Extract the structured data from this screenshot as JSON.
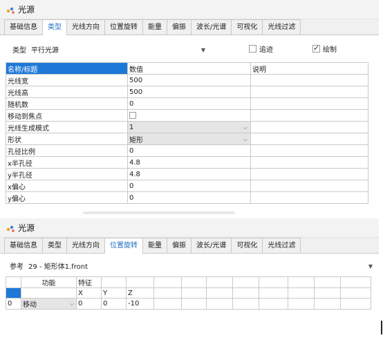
{
  "panel1": {
    "title": "光源",
    "tabs": [
      "基础信息",
      "类型",
      "光线方向",
      "位置旋转",
      "能量",
      "偏振",
      "波长/光谱",
      "可视化",
      "光线过滤"
    ],
    "active_tab": "类型",
    "type_label": "类型",
    "type_value": "平行光源",
    "trace_label": "追迹",
    "trace_checked": false,
    "draw_label": "绘制",
    "draw_checked": true,
    "table": {
      "headers": [
        "名称/标题",
        "数值",
        "说明"
      ],
      "rows": [
        {
          "name": "光线宽",
          "value": "500",
          "note": ""
        },
        {
          "name": "光线高",
          "value": "500",
          "note": ""
        },
        {
          "name": "随机数",
          "value": "0",
          "note": ""
        },
        {
          "name": "移动到焦点",
          "value": "",
          "note": "",
          "checkbox": true
        },
        {
          "name": "光线生成模式",
          "value": "1",
          "note": "",
          "combo": true
        },
        {
          "name": "形状",
          "value": "矩形",
          "note": "",
          "combo": true
        },
        {
          "name": "孔径比例",
          "value": "0",
          "note": ""
        },
        {
          "name": "x半孔径",
          "value": "4.8",
          "note": ""
        },
        {
          "name": "y半孔径",
          "value": "4.8",
          "note": ""
        },
        {
          "name": "x偏心",
          "value": "0",
          "note": ""
        },
        {
          "name": "y偏心",
          "value": "0",
          "note": ""
        }
      ]
    }
  },
  "panel2": {
    "title": "光源",
    "tabs": [
      "基础信息",
      "类型",
      "光线方向",
      "位置旋转",
      "能量",
      "偏振",
      "波长/光谱",
      "可视化",
      "光线过滤"
    ],
    "active_tab": "位置旋转",
    "ref_label": "参考",
    "ref_value": "29 - 矩形体1.front",
    "table": {
      "header1": [
        "",
        "功能",
        "特征",
        "",
        "",
        "",
        "",
        "",
        "",
        "",
        "",
        "",
        ""
      ],
      "header2": [
        "",
        "",
        "X",
        "Y",
        "Z",
        "",
        "",
        "",
        "",
        "",
        "",
        "",
        ""
      ],
      "rows": [
        {
          "index": "0",
          "function": "移动",
          "x": "0",
          "y": "0",
          "z": "-10"
        }
      ]
    }
  },
  "colors": {
    "accent": "#1e6fc8",
    "selection": "#1e78d7"
  }
}
